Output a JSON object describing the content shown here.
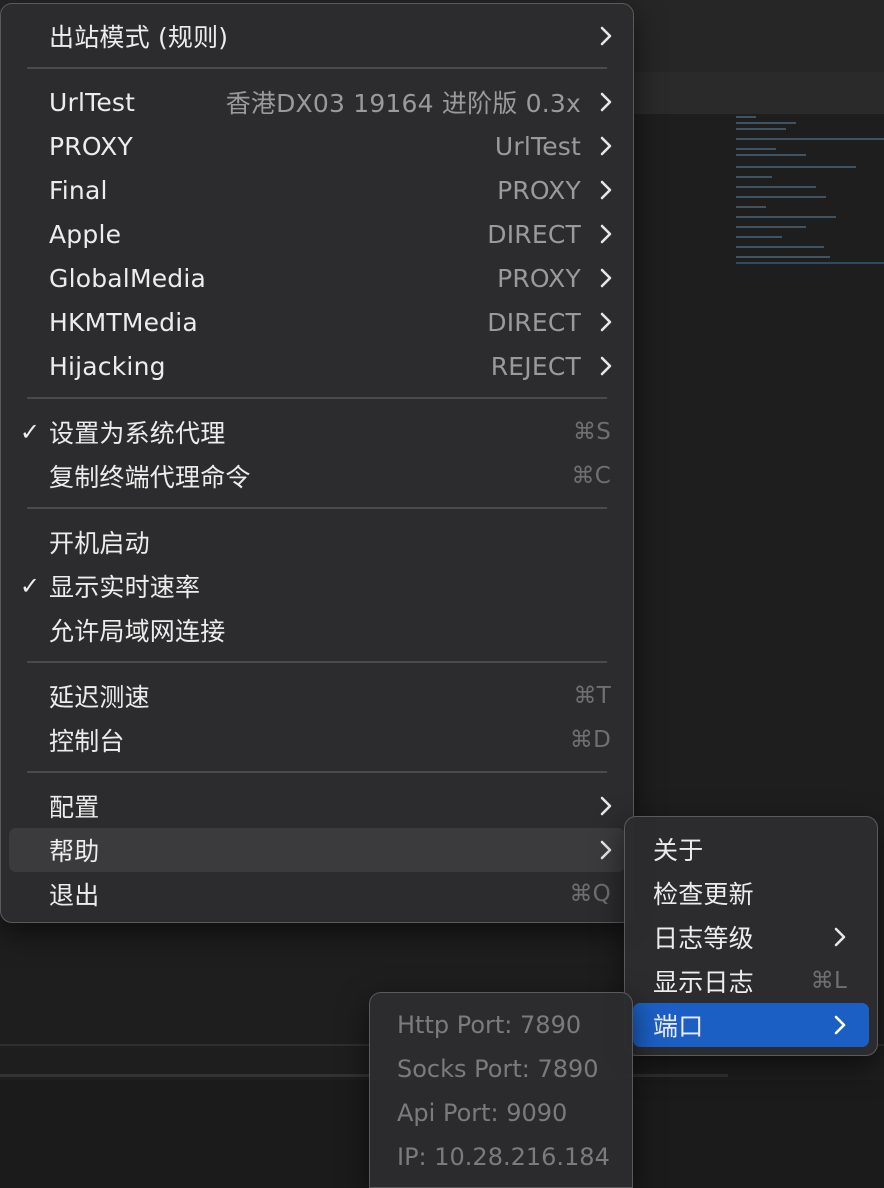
{
  "main_menu": {
    "outbound_mode": {
      "label": "出站模式 (规则)"
    },
    "proxies": [
      {
        "name": "UrlTest",
        "value": "香港DX03 19164 进阶版 0.3x"
      },
      {
        "name": "PROXY",
        "value": "UrlTest"
      },
      {
        "name": "Final",
        "value": "PROXY"
      },
      {
        "name": "Apple",
        "value": "DIRECT"
      },
      {
        "name": "GlobalMedia",
        "value": "PROXY"
      },
      {
        "name": "HKMTMedia",
        "value": "DIRECT"
      },
      {
        "name": "Hijacking",
        "value": "REJECT"
      }
    ],
    "set_system_proxy": {
      "label": "设置为系统代理",
      "shortcut": "⌘S",
      "checked": true
    },
    "copy_terminal": {
      "label": "复制终端代理命令",
      "shortcut": "⌘C"
    },
    "launch_at_login": {
      "label": "开机启动",
      "checked": false
    },
    "show_speed": {
      "label": "显示实时速率",
      "checked": true
    },
    "allow_lan": {
      "label": "允许局域网连接",
      "checked": false
    },
    "latency_test": {
      "label": "延迟测速",
      "shortcut": "⌘T"
    },
    "dashboard": {
      "label": "控制台",
      "shortcut": "⌘D"
    },
    "config": {
      "label": "配置"
    },
    "help": {
      "label": "帮助"
    },
    "quit": {
      "label": "退出",
      "shortcut": "⌘Q"
    },
    "check_glyph": "✓"
  },
  "help_menu": {
    "about": "关于",
    "check_update": "检查更新",
    "log_level": "日志等级",
    "show_log": {
      "label": "显示日志",
      "shortcut": "⌘L"
    },
    "ports": "端口"
  },
  "port_menu": {
    "http": "Http Port: 7890",
    "socks": "Socks Port: 7890",
    "api": "Api Port: 9090",
    "ip": "IP: 10.28.216.184"
  },
  "colors": {
    "menu_bg": "#2c2c2e",
    "highlight": "#3b3b3d",
    "selected": "#1c5fc4",
    "secondary_text": "#9a9a9a",
    "disabled_text": "#7b7b7b"
  }
}
